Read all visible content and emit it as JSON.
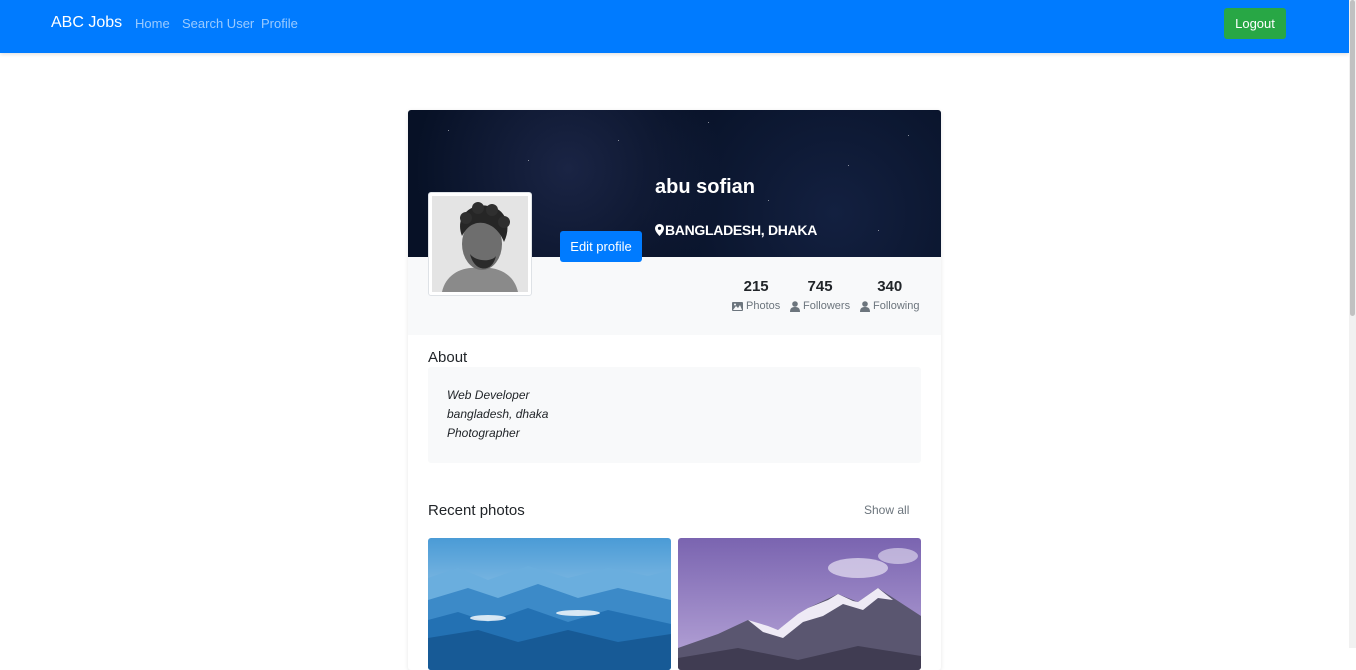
{
  "navbar": {
    "brand": "ABC Jobs",
    "links": [
      "Home",
      "Search User",
      "Profile"
    ],
    "logout_label": "Logout",
    "bg_color": "#007bff",
    "logout_color": "#28a745"
  },
  "profile": {
    "name": "abu sofian",
    "location": "BANGLADESH, DHAKA",
    "edit_label": "Edit profile",
    "stats": [
      {
        "value": "215",
        "label": "Photos",
        "icon": "image-icon"
      },
      {
        "value": "745",
        "label": "Followers",
        "icon": "user-icon"
      },
      {
        "value": "340",
        "label": "Following",
        "icon": "user-icon"
      }
    ]
  },
  "about": {
    "title": "About",
    "lines": [
      "Web Developer",
      "bangladesh, dhaka",
      "Photographer"
    ]
  },
  "recent": {
    "title": "Recent photos",
    "show_all": "Show all"
  }
}
